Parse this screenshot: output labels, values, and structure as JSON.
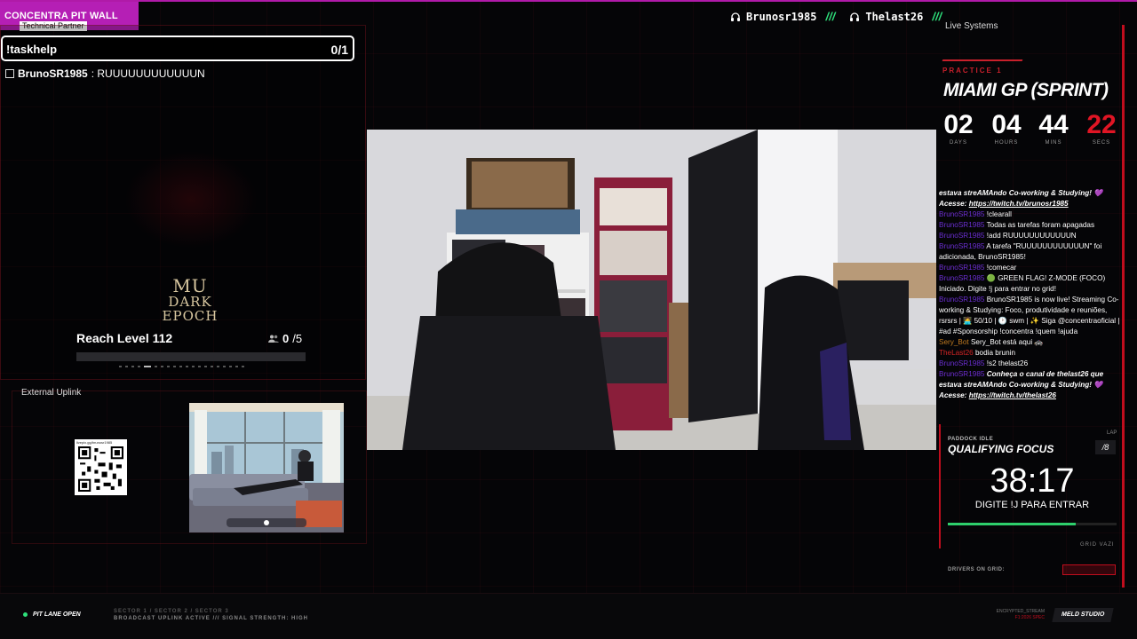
{
  "brand": {
    "name": "CONCENTRA PIT WALL",
    "partner": "Technical Partner"
  },
  "hosts": [
    {
      "name": "Brunosr1985",
      "icon": "headphones-icon"
    },
    {
      "name": "Thelast26",
      "icon": "headphones-icon"
    }
  ],
  "hosts_separator": "///",
  "tasks": {
    "command": "!taskhelp",
    "count": "0/1",
    "items": [
      {
        "user": "BrunoSR1985",
        "text": ": RUUUUUUUUUUUUN",
        "done": false
      }
    ]
  },
  "game": {
    "logo_line1": "MU",
    "logo_line2": "DARK EPOCH",
    "goal": "Reach Level 112",
    "progress_current": "0",
    "progress_total": "/5",
    "progress_fraction": 0
  },
  "external": {
    "title": "External Uplink",
    "qr_caption": "livepix.gg/brunosr1985"
  },
  "right": {
    "title": "Live Systems",
    "session": "PRACTICE 1",
    "race": "MIAMI GP (SPRINT)",
    "countdown": [
      {
        "value": "02",
        "unit": "DAYS"
      },
      {
        "value": "04",
        "unit": "HOURS"
      },
      {
        "value": "44",
        "unit": "MINS"
      },
      {
        "value": "22",
        "unit": "SECS"
      }
    ]
  },
  "chat": [
    {
      "name": "",
      "text": "estava streAMAndo Co-working & Studying! 💜",
      "style": "italic"
    },
    {
      "name": "",
      "text": "Acesse: ",
      "link": "https://twitch.tv/brunosr1985",
      "style": "italic"
    },
    {
      "name": "BrunoSR1985",
      "text": "!clearall"
    },
    {
      "name": "BrunoSR1985",
      "text": "Todas as tarefas foram apagadas"
    },
    {
      "name": "BrunoSR1985",
      "text": "!add RUUUUUUUUUUUUN"
    },
    {
      "name": "BrunoSR1985",
      "text": "A tarefa \"RUUUUUUUUUUUUN\" foi"
    },
    {
      "name": "",
      "text": "adicionada, BrunoSR1985!"
    },
    {
      "name": "BrunoSR1985",
      "text": "!comecar"
    },
    {
      "name": "BrunoSR1985",
      "text": "🟢 GREEN FLAG! Z-MODE (FOCO)"
    },
    {
      "name": "",
      "text": "Iniciado. Digite !j para entrar no grid!"
    },
    {
      "name": "BrunoSR1985",
      "text": "BrunoSR1985 is now live! Streaming Co-"
    },
    {
      "name": "",
      "text": "working & Studying: Foco, produtividade e reuniões,"
    },
    {
      "name": "",
      "text": "rsrsrs | 🧑‍💻 50/10 | 🕑 swm | ✨ Siga @concentraoficial |"
    },
    {
      "name": "",
      "text": "#ad #Sponsorship !concentra !quem !ajuda"
    },
    {
      "name": "Sery_Bot",
      "text": "Sery_Bot está aqui 🚓",
      "color": "o"
    },
    {
      "name": "TheLast26",
      "text": "bodia brunin",
      "color": "r"
    },
    {
      "name": "BrunoSR1985",
      "text": "!s2 thelast26"
    },
    {
      "name": "BrunoSR1985",
      "text": "Conheça o canal de thelast26 que",
      "style": "italic"
    },
    {
      "name": "",
      "text": "estava streAMAndo Co-working & Studying! 💜",
      "style": "italic"
    },
    {
      "name": "",
      "text": "Acesse: ",
      "link": "https://twitch.tv/thelast26",
      "style": "italic"
    }
  ],
  "focus": {
    "label": "PADDOCK IDLE",
    "lap_label": "LAP",
    "title": "QUALIFYING FOCUS",
    "laps": "/8",
    "time": "38:17",
    "subtitle": "DIGITE !J PARA ENTRAR",
    "progress": 0.76,
    "grid_status": "GRID VAZI",
    "drivers_label": "DRIVERS ON GRID:"
  },
  "footer": {
    "pit": "PIT LANE OPEN",
    "sectors": "SECTOR 1 / SECTOR 2 / SECTOR 3",
    "uplink": "BROADCAST UPLINK ACTIVE /// SIGNAL STRENGTH: HIGH",
    "enc_line1": "ENCRYPTED_STREAM",
    "enc_line2": "F1:2026 SPEC",
    "studio": "MELD STUDIO"
  },
  "colors": {
    "accent": "#c00d1d",
    "brand": "#b51fb5",
    "green": "#2ee07b"
  }
}
